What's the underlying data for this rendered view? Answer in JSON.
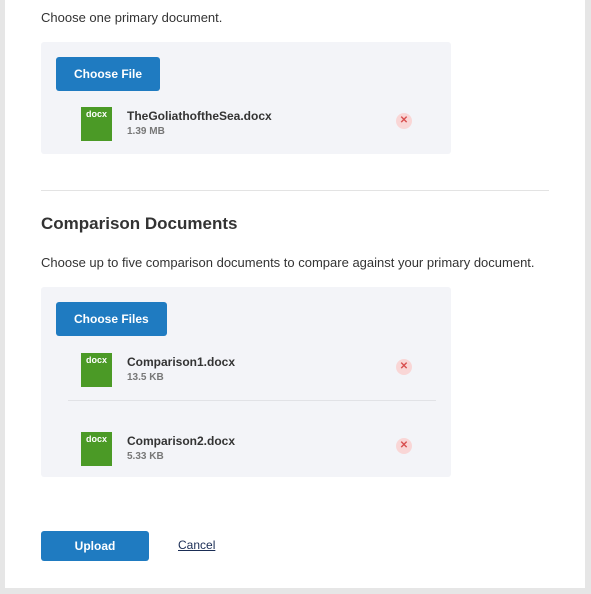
{
  "primary": {
    "instruction": "Choose one primary document.",
    "choose_label": "Choose File",
    "files": [
      {
        "type": "docx",
        "name": "TheGoliathoftheSea.docx",
        "size": "1.39 MB"
      }
    ]
  },
  "comparison": {
    "heading": "Comparison Documents",
    "instruction": "Choose up to five comparison documents to compare against your primary document.",
    "choose_label": "Choose Files",
    "files": [
      {
        "type": "docx",
        "name": "Comparison1.docx",
        "size": "13.5 KB"
      },
      {
        "type": "docx",
        "name": "Comparison2.docx",
        "size": "5.33 KB"
      }
    ]
  },
  "actions": {
    "upload_label": "Upload",
    "cancel_label": "Cancel"
  },
  "icons": {
    "remove": "close-circle-icon",
    "file": "docx-file-icon"
  },
  "colors": {
    "primary_button": "#1f7bc1",
    "docx_badge": "#4b9a26",
    "remove_icon": "#d85050",
    "drop_zone": "#f3f4f8"
  }
}
